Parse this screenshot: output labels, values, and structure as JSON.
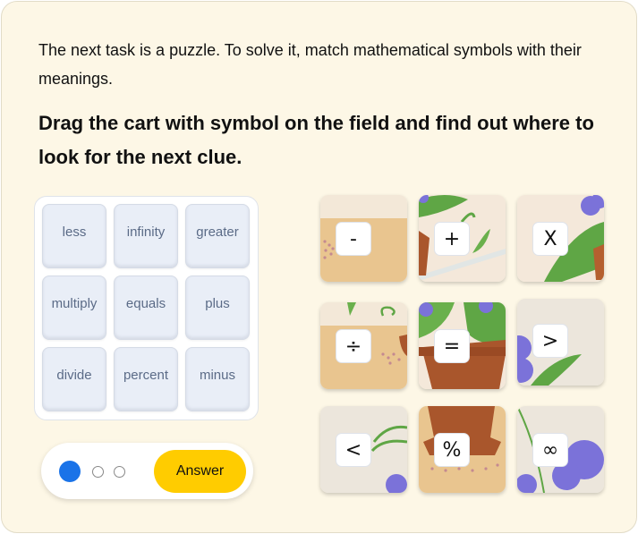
{
  "instructions": {
    "intro": "The next task is a puzzle. To solve it, match mathematical symbols with their meanings.",
    "task": "Drag the cart with symbol on the field and find out where to look for the next clue."
  },
  "words": [
    "less",
    "infinity",
    "greater",
    "multiply",
    "equals",
    "plus",
    "divide",
    "percent",
    "minus"
  ],
  "tiles": [
    {
      "symbol": "-",
      "meaning": "minus"
    },
    {
      "symbol": "+",
      "meaning": "plus"
    },
    {
      "symbol": "X",
      "meaning": "multiply"
    },
    {
      "symbol": "÷",
      "meaning": "divide"
    },
    {
      "symbol": "=",
      "meaning": "equals"
    },
    {
      "symbol": ">",
      "meaning": "greater"
    },
    {
      "symbol": "<",
      "meaning": "less"
    },
    {
      "symbol": "%",
      "meaning": "percent"
    },
    {
      "symbol": "∞",
      "meaning": "infinity"
    }
  ],
  "progress": {
    "current_step": 1,
    "total_steps": 3
  },
  "controls": {
    "answer_label": "Answer"
  },
  "colors": {
    "accent": "#1a73e8",
    "button": "#ffcc00",
    "background": "#fdf7e6"
  }
}
